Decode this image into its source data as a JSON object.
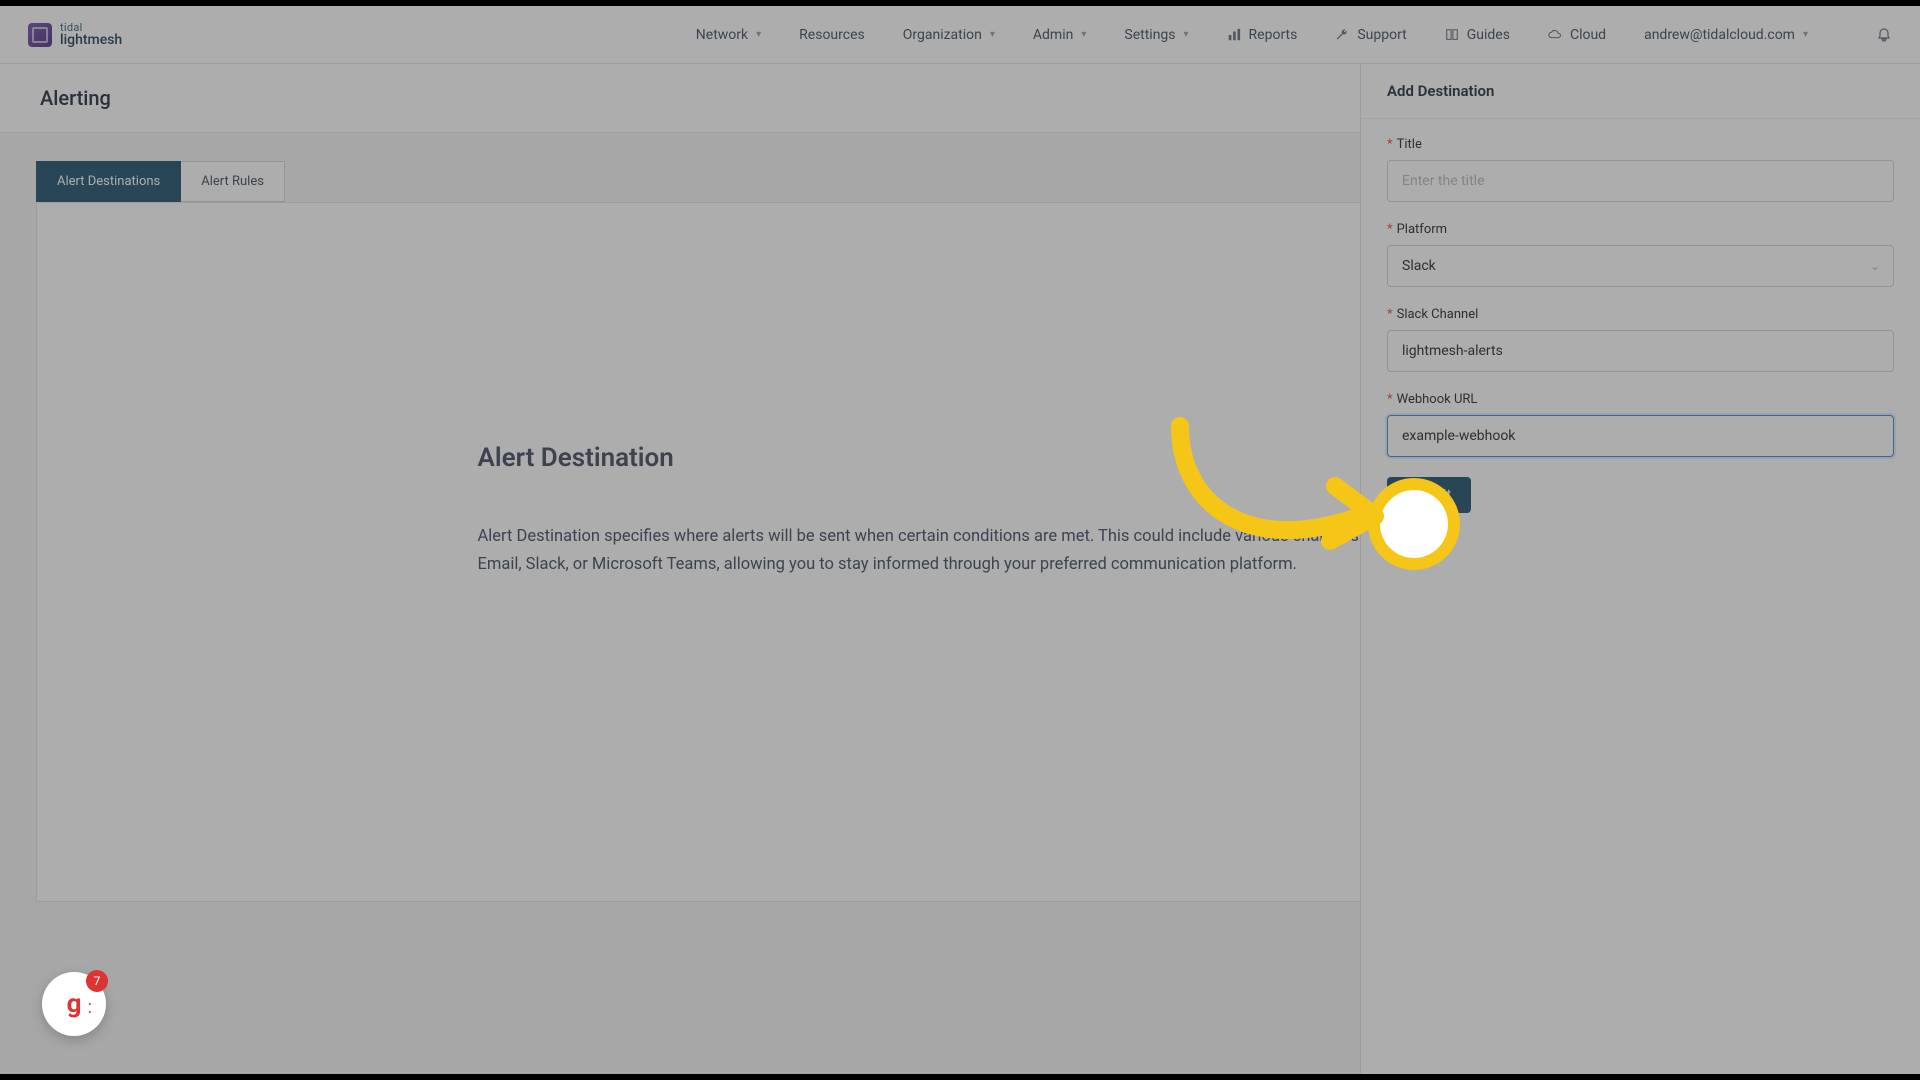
{
  "brand": {
    "line1": "tidal",
    "line2": "lightmesh"
  },
  "nav": {
    "network": "Network",
    "resources": "Resources",
    "organization": "Organization",
    "admin": "Admin",
    "settings": "Settings",
    "reports": "Reports",
    "support": "Support",
    "guides": "Guides",
    "cloud": "Cloud",
    "user_email": "andrew@tidalcloud.com"
  },
  "page": {
    "title": "Alerting"
  },
  "tabs": {
    "destinations": "Alert Destinations",
    "rules": "Alert Rules"
  },
  "panel": {
    "title": "Alert Destination",
    "desc": "Alert Destination specifies where alerts will be sent when certain conditions are met. This could include various channels such as Email, Slack, or Microsoft Teams, allowing you to stay informed through your preferred communication platform."
  },
  "drawer": {
    "header": "Add Destination",
    "title_label": "Title",
    "title_placeholder": "Enter the title",
    "title_value": "",
    "platform_label": "Platform",
    "platform_value": "Slack",
    "slack_channel_label": "Slack Channel",
    "slack_channel_value": "lightmesh-alerts",
    "webhook_label": "Webhook URL",
    "webhook_value": "example-webhook",
    "submit": "Submit"
  },
  "float": {
    "letter": "g",
    "count": "7"
  }
}
